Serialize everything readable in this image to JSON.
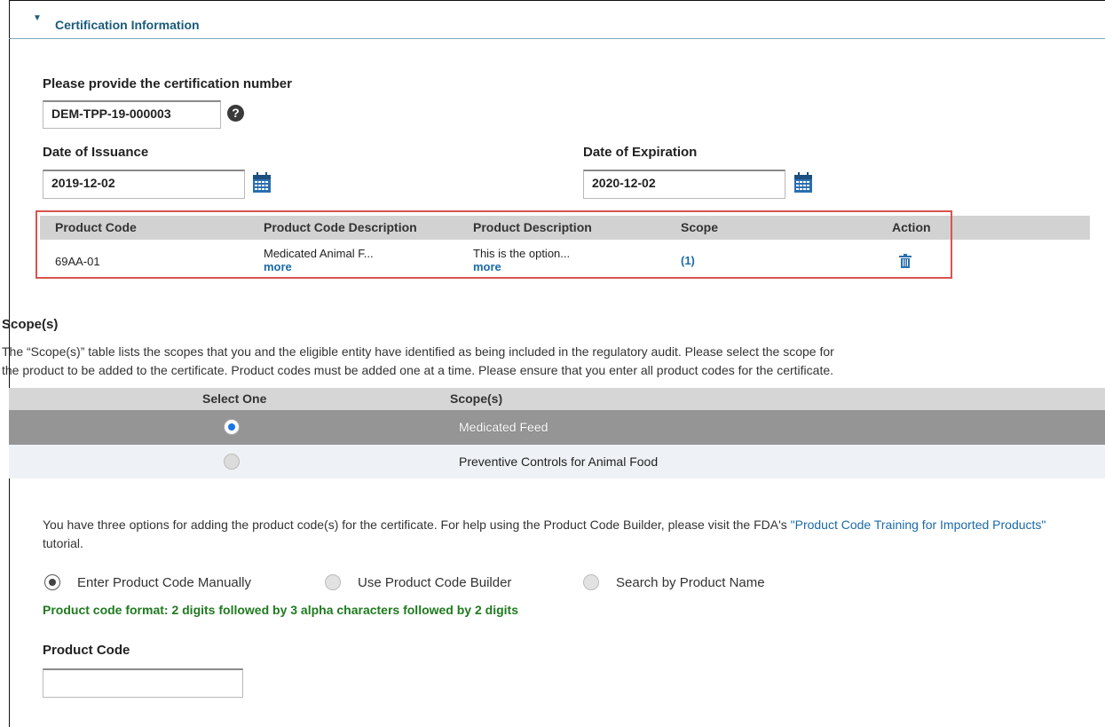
{
  "section": {
    "title": "Certification Information"
  },
  "certification": {
    "label": "Please provide the certification number",
    "value": "DEM-TPP-19-000003",
    "help": "?"
  },
  "issuance": {
    "label": "Date of Issuance",
    "value": "2019-12-02"
  },
  "expiration": {
    "label": "Date of Expiration",
    "value": "2020-12-02"
  },
  "product_table": {
    "headers": [
      "Product Code",
      "Product Code Description",
      "Product Description",
      "Scope",
      "Action"
    ],
    "rows": [
      {
        "code": "69AA-01",
        "code_desc": "Medicated Animal F...",
        "code_desc_more": "more",
        "prod_desc": "This is the option...",
        "prod_desc_more": "more",
        "scope": "(1)"
      }
    ]
  },
  "scopes": {
    "title": "Scope(s)",
    "description": "The “Scope(s)” table lists the scopes that you and the eligible entity have identified as being included in the regulatory audit. Please select the scope for the product to be added to the certificate. Product codes must be added one at a time. Please ensure that you enter all product codes for the certificate.",
    "description_line1": "The “Scope(s)” table lists the scopes that you and the eligible entity have identified as being included in the regulatory audit. Please select the scope for",
    "description_line2": "the product to be added to the certificate. Product codes must be added one at a time. Please ensure that you enter all product codes for the certificate.",
    "headers": [
      "Select One",
      "Scope(s)"
    ],
    "rows": [
      {
        "name": "Medicated Feed",
        "selected": true
      },
      {
        "name": "Preventive Controls for Animal Food",
        "selected": false
      }
    ]
  },
  "options": {
    "intro_1": "You have three options for adding the product code(s) for the certificate. For help using the Product Code Builder, please visit the FDA's ",
    "tutorial_link": "\"Product Code Training for Imported Products\"",
    "intro_2": " tutorial.",
    "choices": [
      "Enter Product Code Manually",
      "Use Product Code Builder",
      "Search by Product Name"
    ],
    "selected_index": 0,
    "format_note": "Product code format: 2 digits followed by 3 alpha characters followed by 2 digits"
  },
  "product_code": {
    "label": "Product Code",
    "value": ""
  },
  "colors": {
    "accent": "#1a5b7a",
    "link": "#1a6aa8",
    "highlight": "#d9534f",
    "note": "#1f7a1f"
  }
}
